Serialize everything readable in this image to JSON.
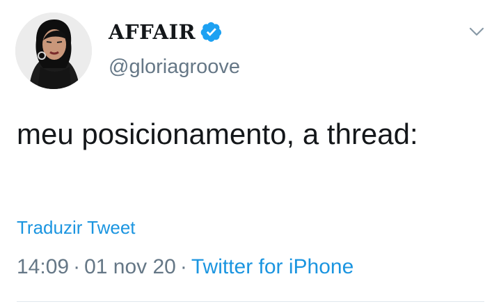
{
  "author": {
    "display_name": "AFFAIR",
    "handle": "@gloriagroove",
    "verified": true,
    "avatar_icon": "profile-photo"
  },
  "tweet": {
    "text": "meu posicionamento, a thread:",
    "translate_label": "Traduzir Tweet",
    "time": "14:09",
    "date": "01 nov 20",
    "separator": "·",
    "source": "Twitter for iPhone"
  },
  "colors": {
    "link": "#1b95e0",
    "verified_badge": "#1da1f2",
    "secondary_text": "#657786",
    "primary_text": "#14171a"
  },
  "icons": {
    "verified": "verified-badge-icon",
    "menu": "chevron-down-icon"
  }
}
